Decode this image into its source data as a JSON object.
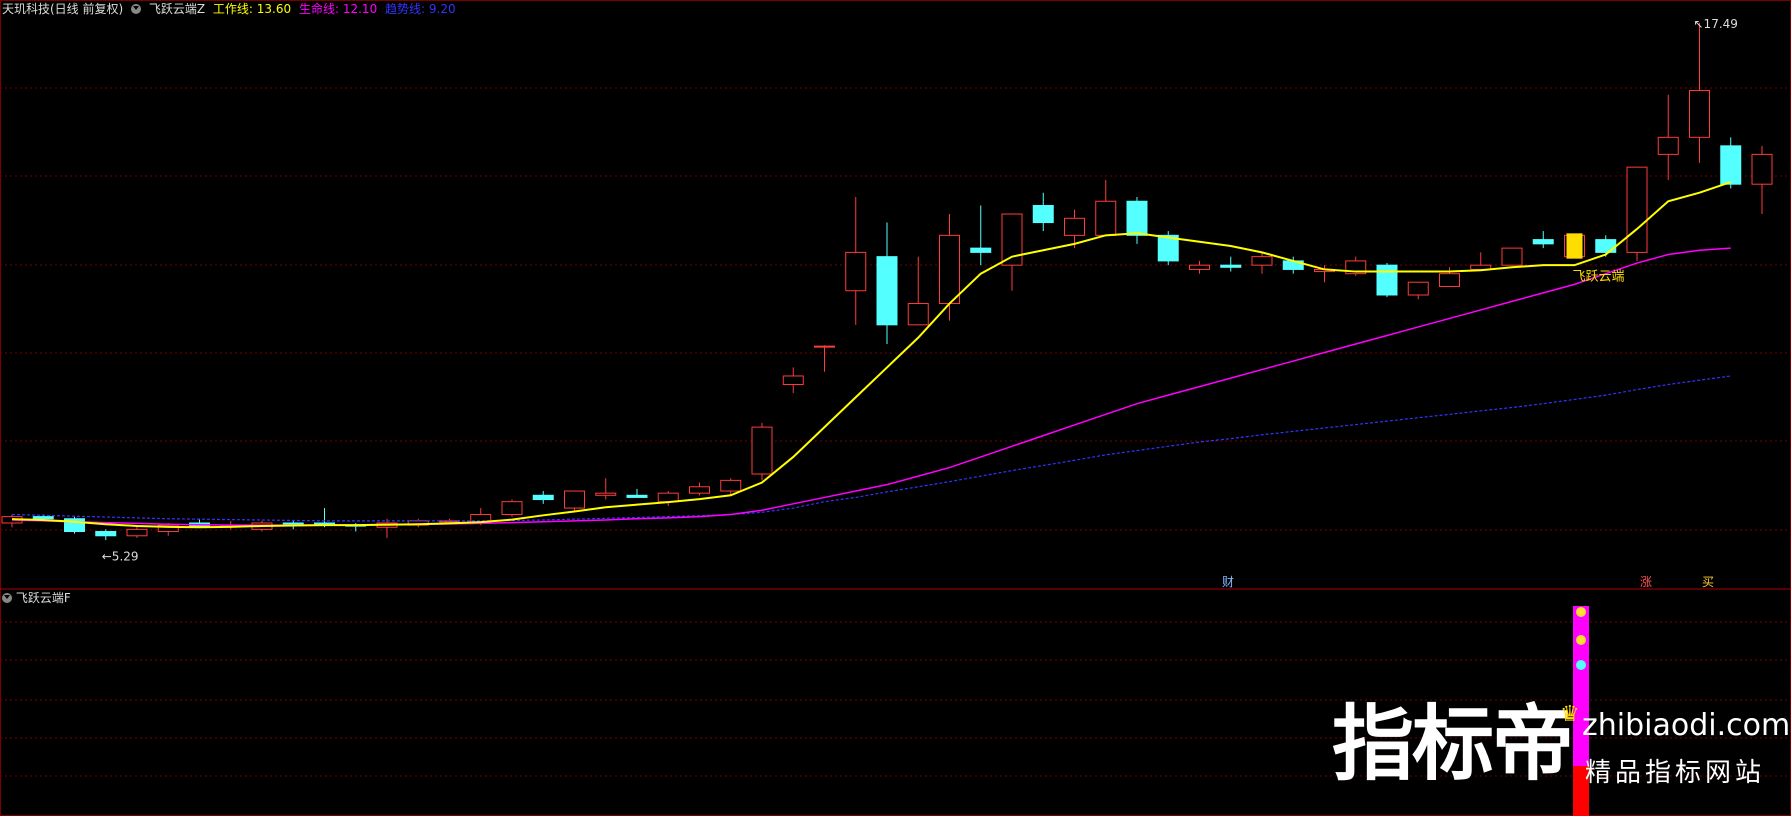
{
  "header": {
    "stock_title": "天玑科技(日线 前复权)",
    "indicator_name": "飞跃云端Z",
    "lines": [
      {
        "label": "工作线:",
        "value": "13.60",
        "color": "#ffff00"
      },
      {
        "label": "生命线:",
        "value": "12.10",
        "color": "#ff00ff"
      },
      {
        "label": "趋势线:",
        "value": "9.20",
        "color": "#3333ff"
      }
    ]
  },
  "sub_panel": {
    "indicator_name": "飞跃云端F"
  },
  "annotations": {
    "high_label": "17.49",
    "low_label": "5.29",
    "signal_label": "飞跃云端",
    "marker_cai": "财",
    "marker_zhang": "涨",
    "marker_mai": "买"
  },
  "watermark": {
    "brand_cn": "指标帝",
    "url": "zhibiaodi.com",
    "tagline": "精品指标网站"
  },
  "colors": {
    "up": "#ff3b3b",
    "down": "#54ffff",
    "grid": "#7a0000",
    "work_line": "#ffff00",
    "life_line": "#ff00ff",
    "trend_line": "#3333ff"
  },
  "chart_data": {
    "type": "candlestick",
    "ylim": [
      4.6,
      17.6
    ],
    "candles": [
      [
        5.75,
        5.95,
        5.65,
        5.9
      ],
      [
        5.9,
        5.95,
        5.8,
        5.85
      ],
      [
        5.85,
        5.9,
        5.5,
        5.55
      ],
      [
        5.55,
        5.6,
        5.35,
        5.45
      ],
      [
        5.45,
        5.7,
        5.4,
        5.6
      ],
      [
        5.55,
        5.75,
        5.45,
        5.7
      ],
      [
        5.75,
        5.85,
        5.7,
        5.65
      ],
      [
        5.7,
        5.8,
        5.6,
        5.7
      ],
      [
        5.6,
        5.8,
        5.55,
        5.75
      ],
      [
        5.75,
        5.8,
        5.6,
        5.7
      ],
      [
        5.75,
        6.1,
        5.65,
        5.7
      ],
      [
        5.7,
        5.75,
        5.55,
        5.68
      ],
      [
        5.65,
        5.85,
        5.4,
        5.75
      ],
      [
        5.7,
        5.85,
        5.65,
        5.8
      ],
      [
        5.8,
        5.85,
        5.75,
        5.8
      ],
      [
        5.75,
        6.1,
        5.7,
        5.95
      ],
      [
        5.95,
        6.3,
        5.9,
        6.25
      ],
      [
        6.4,
        6.5,
        6.2,
        6.3
      ],
      [
        6.1,
        6.5,
        6.0,
        6.5
      ],
      [
        6.4,
        6.8,
        6.3,
        6.45
      ],
      [
        6.4,
        6.55,
        6.35,
        6.35
      ],
      [
        6.25,
        6.5,
        6.15,
        6.45
      ],
      [
        6.45,
        6.7,
        6.4,
        6.6
      ],
      [
        6.5,
        6.8,
        6.4,
        6.75
      ],
      [
        6.9,
        8.1,
        6.75,
        8.0
      ],
      [
        9.0,
        9.4,
        8.8,
        9.2
      ],
      [
        9.9,
        9.92,
        9.3,
        9.9
      ],
      [
        11.2,
        13.4,
        10.4,
        12.1
      ],
      [
        12.0,
        12.8,
        9.95,
        10.4
      ],
      [
        10.4,
        12.0,
        10.4,
        10.9
      ],
      [
        10.9,
        13.0,
        10.5,
        12.5
      ],
      [
        12.2,
        13.2,
        11.8,
        12.1
      ],
      [
        11.8,
        13.0,
        11.2,
        13.0
      ],
      [
        13.2,
        13.5,
        12.6,
        12.8
      ],
      [
        12.5,
        13.1,
        12.2,
        12.9
      ],
      [
        12.5,
        13.8,
        12.5,
        13.3
      ],
      [
        13.3,
        13.4,
        12.3,
        12.5
      ],
      [
        12.5,
        12.6,
        11.8,
        11.9
      ],
      [
        11.7,
        11.9,
        11.6,
        11.8
      ],
      [
        11.8,
        12.0,
        11.65,
        11.75
      ],
      [
        11.8,
        12.1,
        11.6,
        12.0
      ],
      [
        11.9,
        12.0,
        11.6,
        11.7
      ],
      [
        11.65,
        11.8,
        11.4,
        11.7
      ],
      [
        11.6,
        12.0,
        11.55,
        11.9
      ],
      [
        11.8,
        11.85,
        11.05,
        11.1
      ],
      [
        11.1,
        11.4,
        11.0,
        11.4
      ],
      [
        11.3,
        11.75,
        11.3,
        11.6
      ],
      [
        11.7,
        12.1,
        11.7,
        11.8
      ],
      [
        11.8,
        12.2,
        11.8,
        12.2
      ],
      [
        12.4,
        12.6,
        12.2,
        12.3
      ],
      [
        12.0,
        12.5,
        12.0,
        12.5
      ],
      [
        12.4,
        12.5,
        12.0,
        12.1
      ],
      [
        12.1,
        14.1,
        11.9,
        14.1
      ],
      [
        14.4,
        15.8,
        13.8,
        14.8
      ],
      [
        14.8,
        17.49,
        14.2,
        15.9
      ],
      [
        14.6,
        14.8,
        13.6,
        13.7
      ],
      [
        13.7,
        14.6,
        13.0,
        14.4
      ]
    ],
    "work_line": [
      5.84,
      5.82,
      5.78,
      5.72,
      5.68,
      5.66,
      5.65,
      5.66,
      5.68,
      5.69,
      5.7,
      5.7,
      5.71,
      5.72,
      5.74,
      5.77,
      5.83,
      5.93,
      6.02,
      6.12,
      6.18,
      6.24,
      6.31,
      6.4,
      6.7,
      7.3,
      8.0,
      8.7,
      9.4,
      10.1,
      10.9,
      11.6,
      12.0,
      12.15,
      12.3,
      12.5,
      12.55,
      12.45,
      12.35,
      12.25,
      12.1,
      11.9,
      11.7,
      11.65,
      11.65,
      11.65,
      11.65,
      11.68,
      11.75,
      11.8,
      11.8,
      12.05,
      12.65,
      13.3,
      13.5,
      13.75
    ],
    "life_line": [
      5.82,
      5.8,
      5.78,
      5.76,
      5.74,
      5.72,
      5.71,
      5.7,
      5.7,
      5.7,
      5.7,
      5.7,
      5.71,
      5.72,
      5.73,
      5.74,
      5.76,
      5.78,
      5.8,
      5.82,
      5.85,
      5.87,
      5.9,
      5.95,
      6.05,
      6.2,
      6.35,
      6.5,
      6.65,
      6.85,
      7.05,
      7.3,
      7.55,
      7.8,
      8.05,
      8.3,
      8.55,
      8.75,
      8.95,
      9.15,
      9.35,
      9.55,
      9.75,
      9.95,
      10.15,
      10.35,
      10.55,
      10.75,
      10.95,
      11.15,
      11.35,
      11.6,
      11.85,
      12.05,
      12.15,
      12.2
    ],
    "trend_line": [
      5.95,
      5.93,
      5.91,
      5.89,
      5.87,
      5.85,
      5.84,
      5.83,
      5.82,
      5.81,
      5.8,
      5.8,
      5.8,
      5.8,
      5.8,
      5.8,
      5.81,
      5.82,
      5.84,
      5.86,
      5.88,
      5.9,
      5.92,
      5.95,
      6.0,
      6.1,
      6.25,
      6.35,
      6.48,
      6.6,
      6.72,
      6.85,
      6.98,
      7.1,
      7.22,
      7.35,
      7.45,
      7.55,
      7.65,
      7.73,
      7.82,
      7.9,
      7.98,
      8.06,
      8.14,
      8.22,
      8.3,
      8.38,
      8.46,
      8.55,
      8.65,
      8.75,
      8.88,
      9.0,
      9.1,
      9.2
    ]
  }
}
